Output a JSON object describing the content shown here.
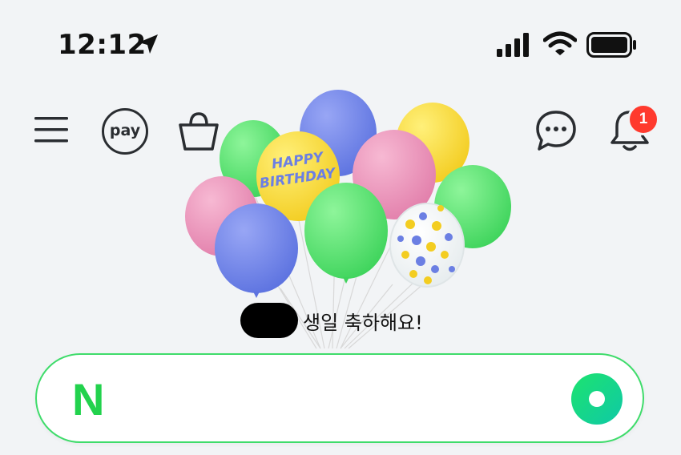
{
  "status_bar": {
    "time": "12:12",
    "icons": [
      "location-arrow-icon",
      "cellular-signal-icon",
      "wifi-icon",
      "battery-icon"
    ]
  },
  "nav": {
    "menu_icon": "hamburger-menu-icon",
    "pay_label": "pay",
    "shopping_icon": "shopping-bag-icon",
    "chat_icon": "chat-bubble-icon",
    "bell_icon": "bell-icon",
    "notification_count": "1"
  },
  "banner": {
    "balloon_text_line1": "HAPPY",
    "balloon_text_line2": "BIRTHDAY",
    "message": "생일 축하해요!"
  },
  "search": {
    "logo_text": "N",
    "lens_icon": "green-dot-lens-icon"
  },
  "colors": {
    "accent_green": "#22d24d",
    "badge_red": "#ff3a2e",
    "background": "#f2f4f6"
  }
}
